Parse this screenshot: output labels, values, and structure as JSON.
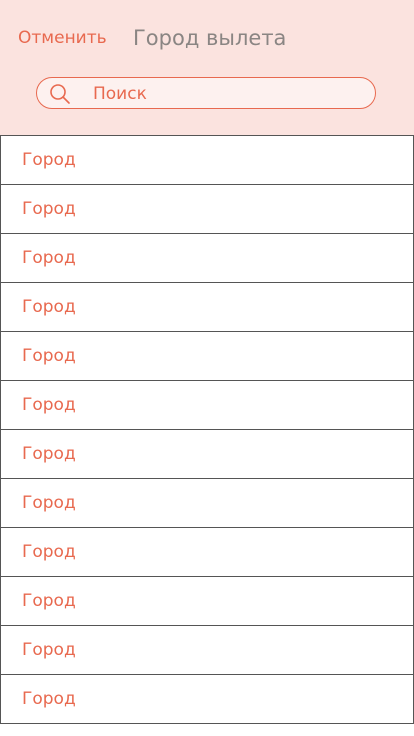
{
  "header": {
    "cancel_label": "Отменить",
    "title": "Город вылета"
  },
  "search": {
    "placeholder": "Поиск",
    "value": "",
    "icon": "search-icon"
  },
  "cities": [
    {
      "label": "Город"
    },
    {
      "label": "Город"
    },
    {
      "label": "Город"
    },
    {
      "label": "Город"
    },
    {
      "label": "Город"
    },
    {
      "label": "Город"
    },
    {
      "label": "Город"
    },
    {
      "label": "Город"
    },
    {
      "label": "Город"
    },
    {
      "label": "Город"
    },
    {
      "label": "Город"
    },
    {
      "label": "Город"
    }
  ],
  "colors": {
    "accent": "#e8694f",
    "header_bg": "#fbe3df",
    "title": "#8a8583",
    "row_border": "#555555"
  }
}
